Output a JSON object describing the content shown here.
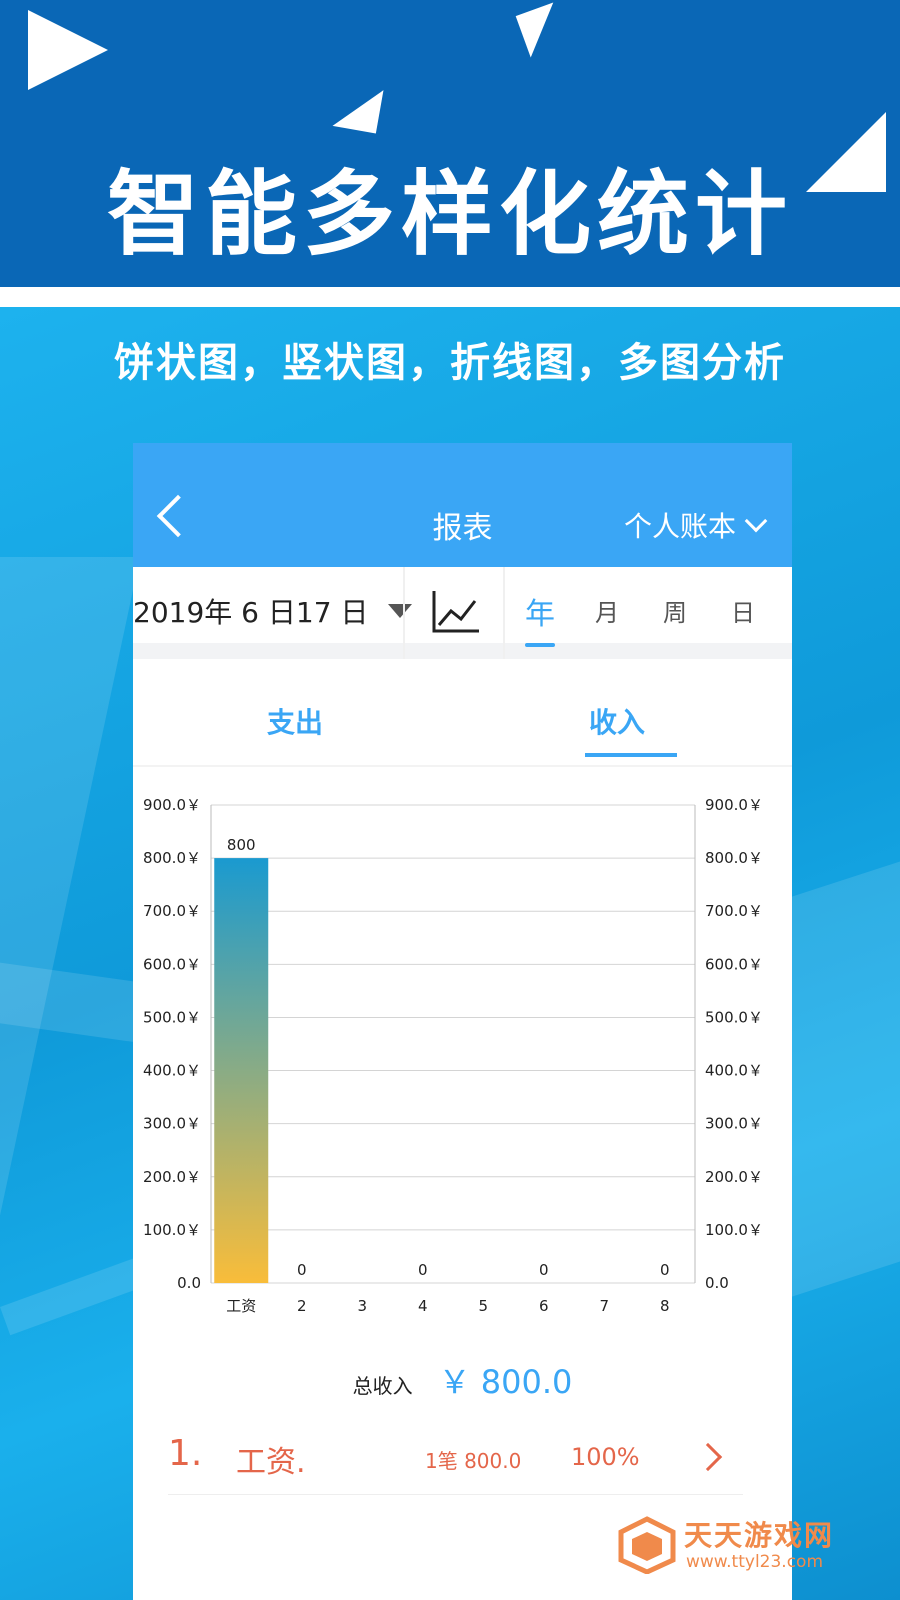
{
  "banner": {
    "title": "智能多样化统计"
  },
  "subtitle": "饼状图，竖状图，折线图，多图分析",
  "nav": {
    "title": "报表",
    "book_selector": "个人账本"
  },
  "toolbar": {
    "date": "2019年 6 日17 日",
    "chart_type_icon": "line-chart-icon",
    "periods": [
      "年",
      "月",
      "周",
      "日"
    ],
    "active_period": "年"
  },
  "tabs": {
    "items": [
      "支出",
      "收入"
    ],
    "active": "收入"
  },
  "chart_data": {
    "type": "bar",
    "categories": [
      "工资",
      "2",
      "3",
      "4",
      "5",
      "6",
      "7",
      "8"
    ],
    "values": [
      800,
      null,
      null,
      0,
      null,
      0,
      null,
      0
    ],
    "data_labels": [
      "800",
      "0",
      "",
      "0",
      "",
      "0",
      "",
      "0"
    ],
    "y_ticks_left": [
      "0.0",
      "100.0￥",
      "200.0￥",
      "300.0￥",
      "400.0￥",
      "500.0￥",
      "600.0￥",
      "700.0￥",
      "800.0￥",
      "900.0￥"
    ],
    "y_ticks_right": [
      "0.0",
      "100.0￥",
      "200.0￥",
      "300.0￥",
      "400.0￥",
      "500.0￥",
      "600.0￥",
      "700.0￥",
      "800.0￥",
      "900.0￥"
    ],
    "ylim": [
      0,
      900
    ],
    "grid": true,
    "colors": {
      "bar_top": "#1a9ad0",
      "bar_bottom": "#f9bd3a"
    },
    "title": "",
    "xlabel": "",
    "ylabel": ""
  },
  "summary": {
    "label": "总收入",
    "amount": "￥ 800.0"
  },
  "list": [
    {
      "index": "1.",
      "name": "工资.",
      "count": "1笔 800.0",
      "percent": "100%"
    }
  ],
  "watermark": {
    "name": "天天游戏网",
    "url": "www.ttyl23.com"
  },
  "colors": {
    "banner": "#0a67b6",
    "accent": "#3aa6f5",
    "list_text": "#e4664a",
    "watermark": "#f08a4b"
  }
}
